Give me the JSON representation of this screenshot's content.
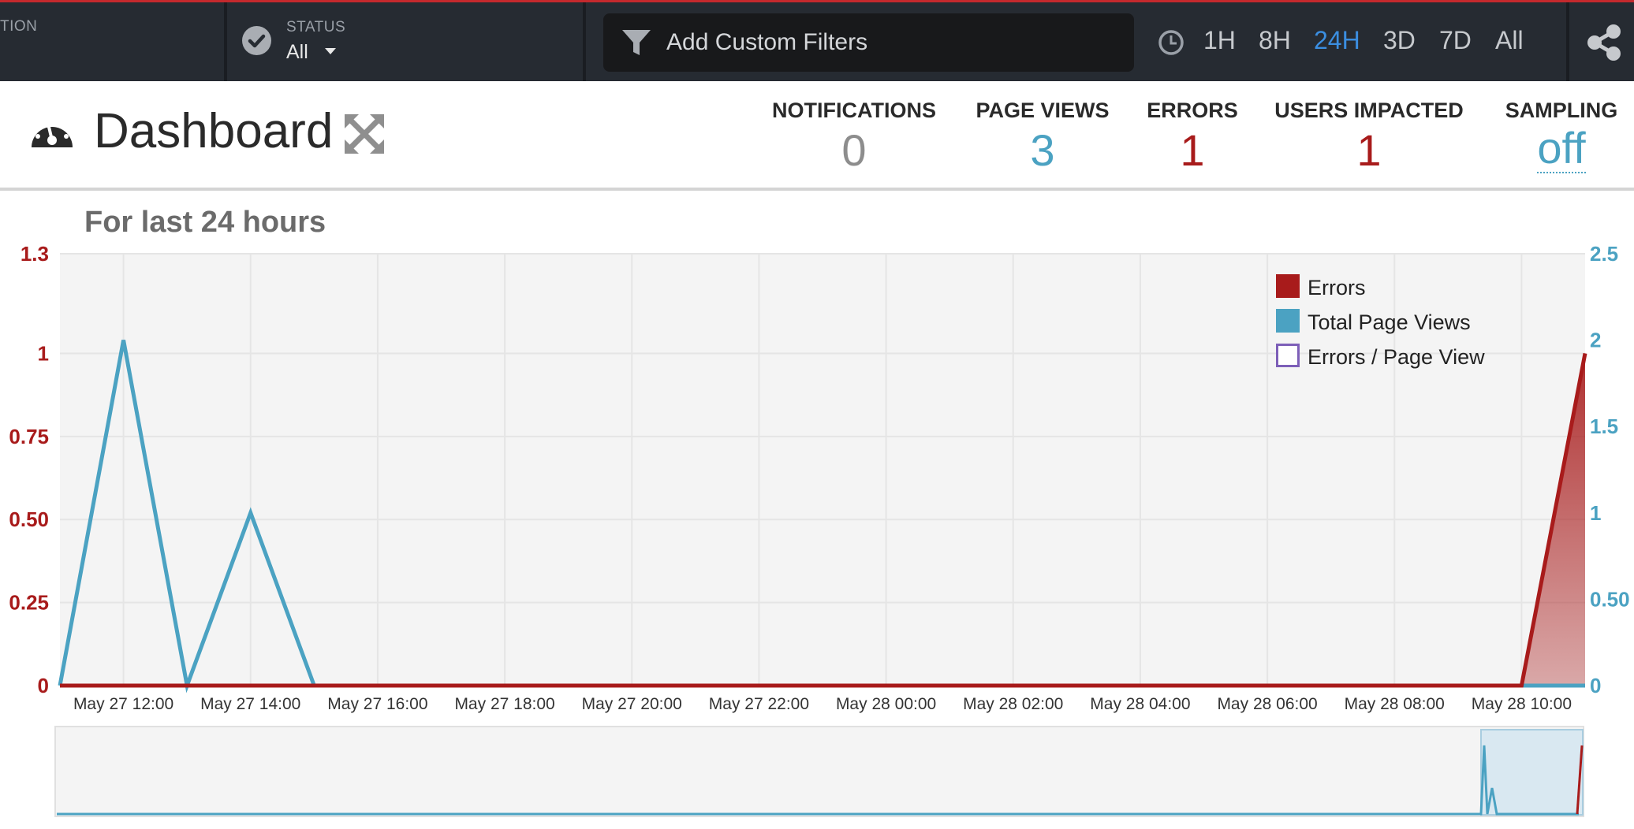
{
  "topbar": {
    "left_partial_label": "TION",
    "status_label": "STATUS",
    "status_value": "All",
    "filter_placeholder": "Add Custom Filters",
    "time_ranges": [
      "1H",
      "8H",
      "24H",
      "3D",
      "7D",
      "All"
    ],
    "active_range": "24H",
    "accent_color": "#c4292d"
  },
  "header": {
    "title": "Dashboard",
    "stats": [
      {
        "label": "NOTIFICATIONS",
        "value": "0"
      },
      {
        "label": "PAGE VIEWS",
        "value": "3"
      },
      {
        "label": "ERRORS",
        "value": "1"
      },
      {
        "label": "USERS IMPACTED",
        "value": "1"
      },
      {
        "label": "SAMPLING",
        "value": "off"
      }
    ]
  },
  "chart_title": "For last 24 hours",
  "chart_data": {
    "type": "area",
    "x": [
      "May 27 11:00",
      "May 27 12:00",
      "May 27 13:00",
      "May 27 14:00",
      "May 27 15:00",
      "May 27 16:00",
      "May 27 18:00",
      "May 27 20:00",
      "May 27 22:00",
      "May 28 00:00",
      "May 28 02:00",
      "May 28 04:00",
      "May 28 06:00",
      "May 28 08:00",
      "May 28 10:00",
      "May 28 11:00"
    ],
    "x_tick_labels": [
      "May 27 12:00",
      "May 27 14:00",
      "May 27 16:00",
      "May 27 18:00",
      "May 27 20:00",
      "May 27 22:00",
      "May 28 00:00",
      "May 28 02:00",
      "May 28 04:00",
      "May 28 06:00",
      "May 28 08:00",
      "May 28 10:00"
    ],
    "series": [
      {
        "name": "Errors",
        "axis": "left",
        "color": "#a81b1b",
        "values": [
          0,
          0,
          0,
          0,
          0,
          0,
          0,
          0,
          0,
          0,
          0,
          0,
          0,
          0,
          0,
          1
        ]
      },
      {
        "name": "Total Page Views",
        "axis": "right",
        "color": "#4ba2c2",
        "values": [
          0,
          2,
          0,
          1,
          0,
          0,
          0,
          0,
          0,
          0,
          0,
          0,
          0,
          0,
          0,
          0
        ]
      },
      {
        "name": "Errors / Page View",
        "axis": "left",
        "color": "#7d5fb8",
        "values": []
      }
    ],
    "y_left": {
      "ticks": [
        "0",
        "0.25",
        "0.50",
        "0.75",
        "1",
        "1.3"
      ],
      "ylim": [
        0,
        1.3
      ]
    },
    "y_right": {
      "ticks": [
        "0",
        "0.50",
        "1",
        "1.5",
        "2",
        "2.5"
      ],
      "ylim": [
        0,
        2.5
      ]
    },
    "grid": true,
    "legend": "top-right"
  }
}
